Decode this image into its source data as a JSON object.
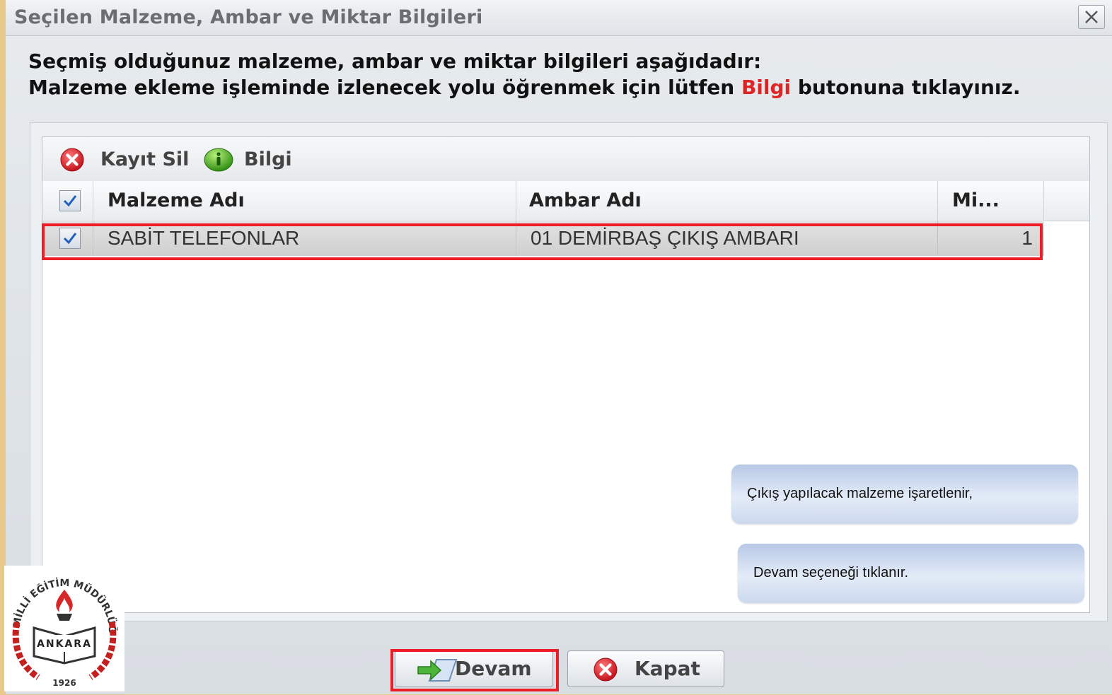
{
  "window": {
    "title": "Seçilen Malzeme, Ambar ve Miktar Bilgileri",
    "close_icon": "close-icon"
  },
  "instructions": {
    "line1": "Seçmiş olduğunuz malzeme, ambar ve miktar bilgileri aşağıdadır:",
    "line2_before": "Malzeme ekleme işleminde izlenecek yolu öğrenmek için lütfen",
    "line2_highlight": "Bilgi",
    "line2_after": "butonuna tıklayınız.",
    "highlight_color": "#e02424"
  },
  "toolbar": {
    "delete_label": "Kayıt Sil",
    "delete_icon": "delete-red-circle-icon",
    "info_label": "Bilgi",
    "info_icon": "info-green-circle-icon"
  },
  "table": {
    "columns": [
      "Malzeme Adı",
      "Ambar Adı",
      "Mi..."
    ],
    "header_checked": true,
    "rows": [
      {
        "checked": true,
        "malzeme": "SABİT TELEFONLAR",
        "ambar": "01 DEMİRBAŞ ÇIKIŞ AMBARI",
        "miktar": "1"
      }
    ]
  },
  "annotations": {
    "note1": "Çıkış yapılacak malzeme işaretlenir,",
    "note2": "Devam seçeneği tıklanır.",
    "highlight_color": "#ee1c24"
  },
  "buttons": {
    "continue_label": "Devam",
    "continue_icon": "arrow-forward-icon",
    "close_label": "Kapat",
    "close_icon": "delete-red-circle-icon"
  },
  "logo": {
    "top_text": "MİLLİ EĞİTİM MÜDÜRLÜĞÜ",
    "center_text": "ANKARA",
    "year": "1926"
  }
}
